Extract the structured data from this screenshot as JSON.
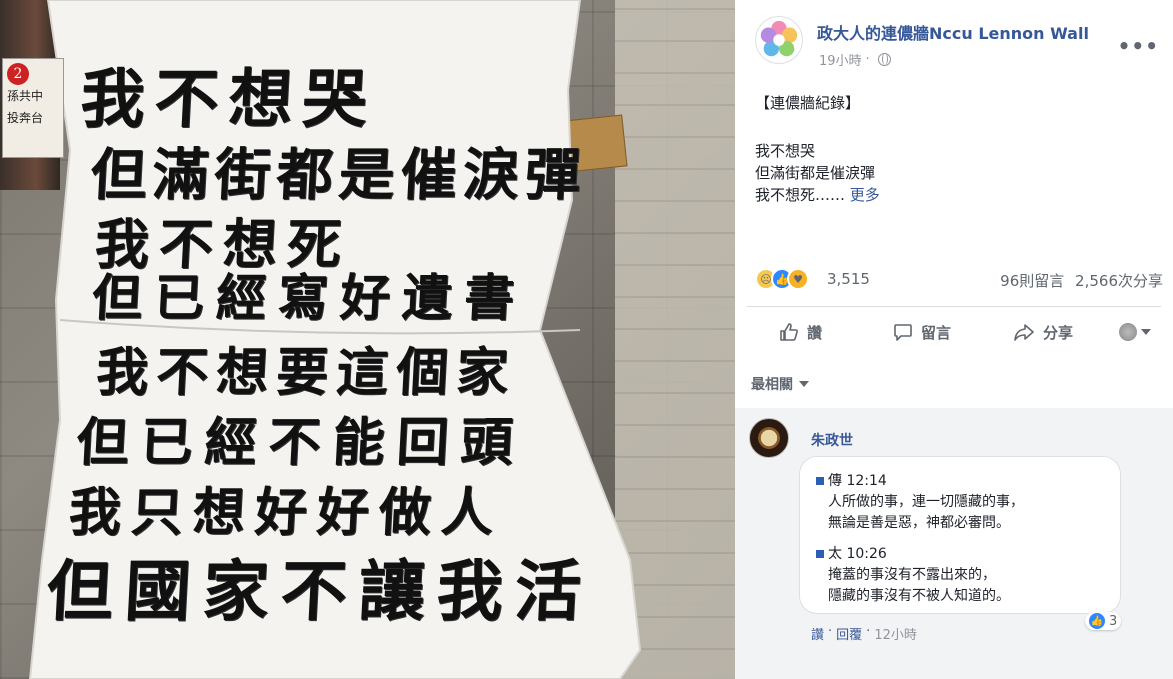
{
  "photo": {
    "poster_lines": [
      "我不想哭",
      "但滿街都是催淚彈",
      "我不想死",
      "但已經寫好遺書",
      "我不想要這個家",
      "但已經不能回頭",
      "我只想好好做人",
      "但國家不讓我活"
    ],
    "side_poster_text": [
      "2",
      "孫共中",
      "投奔台"
    ]
  },
  "post": {
    "page_name": "政大人的連儂牆Nccu Lennon Wall",
    "time": "19小時",
    "more_icon": "more-dots-icon",
    "tag_line": "【連儂牆紀錄】",
    "lines": [
      "我不想哭",
      "但滿街都是催淚彈",
      "我不想死……"
    ],
    "see_more": "更多",
    "reaction_count": "3,515",
    "comments_count": "96則留言",
    "shares_count": "2,566次分享",
    "actions": {
      "like": "讚",
      "comment": "留言",
      "share": "分享"
    }
  },
  "comments": {
    "sort_label": "最相關",
    "items": [
      {
        "author": "朱政世",
        "verses": [
          {
            "ref": "傳 12:14",
            "text": [
              "人所做的事，連一切隱藏的事，",
              "無論是善是惡，神都必審問。"
            ]
          },
          {
            "ref": "太 10:26",
            "text": [
              "掩蓋的事沒有不露出來的，",
              "隱藏的事沒有不被人知道的。"
            ]
          }
        ],
        "like_count": "3",
        "like_label": "讚",
        "reply_label": "回覆",
        "time": "12小時"
      }
    ]
  },
  "colors": {
    "link": "#365899",
    "meta": "#90949c",
    "like_blue": "#2d88ff",
    "comment_bg": "#f2f3f5"
  }
}
